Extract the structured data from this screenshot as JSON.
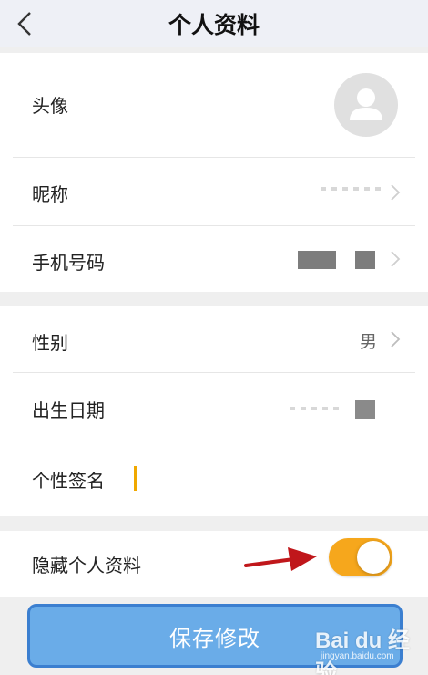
{
  "header": {
    "title": "个人资料"
  },
  "profile": {
    "avatar_label": "头像",
    "nickname_label": "昵称",
    "phone_label": "手机号码"
  },
  "details": {
    "gender_label": "性别",
    "gender_value": "男",
    "birthday_label": "出生日期",
    "signature_label": "个性签名"
  },
  "privacy": {
    "hide_profile_label": "隐藏个人资料",
    "hide_profile_on": true
  },
  "actions": {
    "save_label": "保存修改"
  },
  "watermark": {
    "main": "Bai du 经验",
    "sub": "jingyan.baidu.com"
  },
  "colors": {
    "toggle_on": "#f6a71c",
    "save_button": "#6aace8",
    "cursor": "#f0a800",
    "annotation_arrow": "#c0171b"
  }
}
